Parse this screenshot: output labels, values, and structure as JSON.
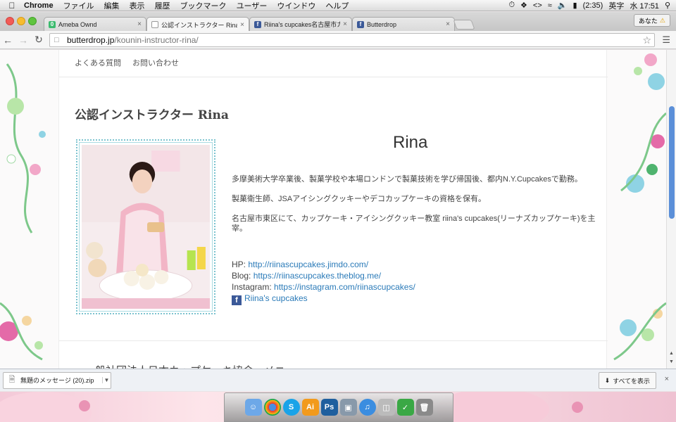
{
  "menubar": {
    "app_name": "Chrome",
    "items": [
      "ファイル",
      "編集",
      "表示",
      "履歴",
      "ブックマーク",
      "ユーザー",
      "ウインドウ",
      "ヘルプ"
    ],
    "battery": "(2:35)",
    "input_method": "英字",
    "clock": "水 17:51"
  },
  "tabs": [
    {
      "title": "Ameba Ownd",
      "icon": "ameba-icon",
      "active": false
    },
    {
      "title": "公認インストラクター Rina",
      "icon": "page-icon",
      "active": true
    },
    {
      "title": "Riina's cupcakes名古屋市カ",
      "icon": "facebook-icon",
      "active": false
    },
    {
      "title": "Butterdrop",
      "icon": "facebook-icon",
      "active": false
    }
  ],
  "profile_label": "あなた",
  "address": {
    "host": "butterdrop.jp",
    "path": "/kounin-instructor-rina/"
  },
  "page": {
    "nav": [
      "よくある質問",
      "お問い合わせ"
    ],
    "title": "公認インストラクター Rina",
    "name": "Rina",
    "bio": [
      "多摩美術大学卒業後、製菓学校や本場ロンドンで製菓技術を学び帰国後、都内N.Y.Cupcakesで勤務。",
      "製菓衛生師、JSAアイシングクッキーやデコカップケーキの資格を保有。",
      "名古屋市東区にて、カップケーキ・アイシングクッキー教室 riina's cupcakes(リーナズカップケーキ)を主宰。"
    ],
    "links": {
      "hp_label": "HP:",
      "hp_url": "http://riinascupcakes.jimdo.com/",
      "blog_label": "Blog:",
      "blog_url": "https://riinascupcakes.theblog.me/",
      "instagram_label": "Instagram:",
      "instagram_url": "https://instagram.com/riinascupcakes/",
      "facebook_text": "Riina's cupcakes"
    },
    "cut_heading": "一般社団法人日本カップケーキ協会　メニュー"
  },
  "download": {
    "filename": "無題のメッセージ (20).zip",
    "show_all": "すべてを表示"
  },
  "colors": {
    "link": "#2a7ab8",
    "scroll_thumb": "#5b8fd8",
    "facebook": "#3b5998",
    "frame": "#7cc3cf"
  }
}
